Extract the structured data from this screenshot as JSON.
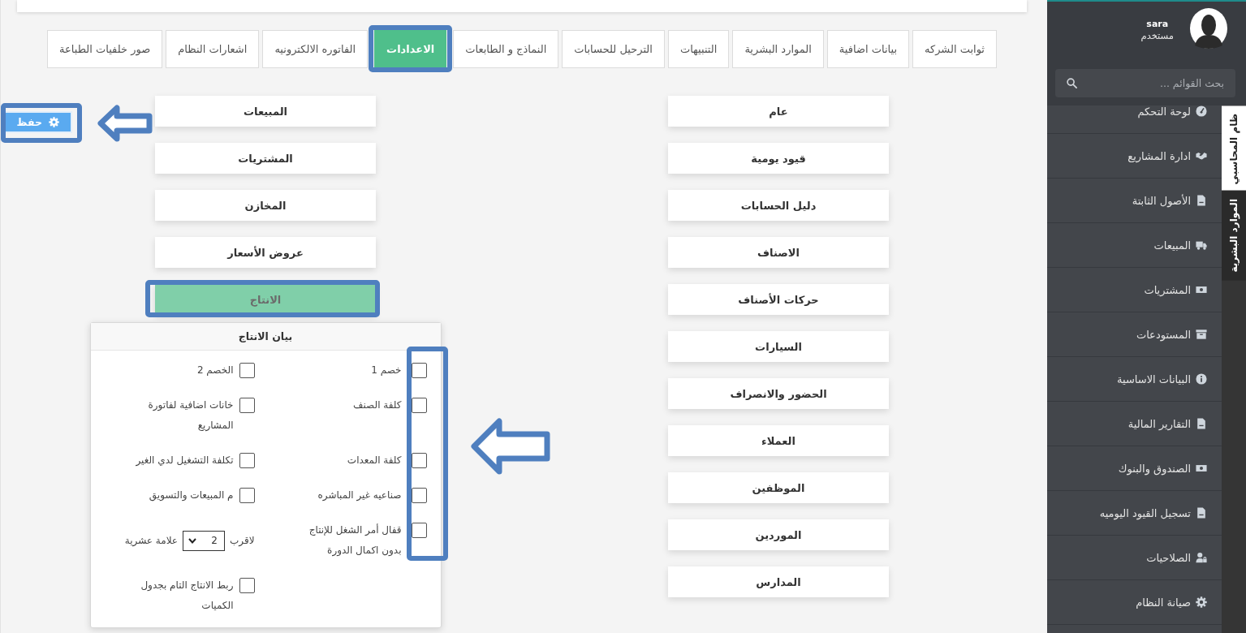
{
  "tabs": [
    {
      "label": "ثوابت الشركه",
      "selected": false,
      "annotated": false
    },
    {
      "label": "بيانات اضافية",
      "selected": false,
      "annotated": false
    },
    {
      "label": "الموارد البشرية",
      "selected": false,
      "annotated": false
    },
    {
      "label": "التنبيهات",
      "selected": false,
      "annotated": false
    },
    {
      "label": "الترحيل للحسابات",
      "selected": false,
      "annotated": false
    },
    {
      "label": "النماذج و الطابعات",
      "selected": false,
      "annotated": false
    },
    {
      "label": "الاعدادات",
      "selected": true,
      "annotated": true
    },
    {
      "label": "الفاتوره الالكترونيه",
      "selected": false,
      "annotated": false
    },
    {
      "label": "اشعارات النظام",
      "selected": false,
      "annotated": false
    },
    {
      "label": "صور خلفيات الطباعة",
      "selected": false,
      "annotated": false
    }
  ],
  "save_button": {
    "label": "حفظ",
    "annotated": true
  },
  "settings": {
    "right_column": [
      {
        "label": "عام",
        "selected": false,
        "annotated": false
      },
      {
        "label": "قيود يومية",
        "selected": false,
        "annotated": false
      },
      {
        "label": "دليل الحسابات",
        "selected": false,
        "annotated": false
      },
      {
        "label": "الاصناف",
        "selected": false,
        "annotated": false
      },
      {
        "label": "حركات الأصناف",
        "selected": false,
        "annotated": false
      },
      {
        "label": "السيارات",
        "selected": false,
        "annotated": false
      },
      {
        "label": "الحضور والانصراف",
        "selected": false,
        "annotated": false
      },
      {
        "label": "العملاء",
        "selected": false,
        "annotated": false
      },
      {
        "label": "الموظفين",
        "selected": false,
        "annotated": false
      },
      {
        "label": "الموردين",
        "selected": false,
        "annotated": false
      },
      {
        "label": "المدارس",
        "selected": false,
        "annotated": false
      }
    ],
    "left_column": [
      {
        "label": "المبيعات",
        "selected": false,
        "annotated": false
      },
      {
        "label": "المشتريات",
        "selected": false,
        "annotated": false
      },
      {
        "label": "المخازن",
        "selected": false,
        "annotated": false
      },
      {
        "label": "عروض الأسعار",
        "selected": false,
        "annotated": false
      },
      {
        "label": "الانتاج",
        "selected": true,
        "annotated": true
      }
    ]
  },
  "production_panel": {
    "title": "بيان الانتاج",
    "annotated": true,
    "right_items": [
      {
        "kind": "checkbox",
        "label": "خصم 1",
        "checked": false
      },
      {
        "kind": "checkbox",
        "label": "كلفة الصنف",
        "checked": false
      },
      {
        "kind": "checkbox",
        "label": "كلفة المعدات",
        "checked": false
      },
      {
        "kind": "checkbox",
        "label": "صناعيه غير المباشره",
        "checked": false
      },
      {
        "kind": "checkbox",
        "label": "قفال أمر الشغل للإنتاج بدون اكمال الدورة",
        "checked": false
      }
    ],
    "left_items": [
      {
        "kind": "checkbox",
        "label": "الخصم 2",
        "checked": false
      },
      {
        "kind": "checkbox",
        "label": "خانات اضافية لفاتورة المشاريع",
        "checked": false
      },
      {
        "kind": "checkbox",
        "label": "تكلفة التشغيل لدي الغير",
        "checked": false
      },
      {
        "kind": "checkbox",
        "label": "م المبيعات والتسويق",
        "checked": false
      },
      {
        "kind": "select",
        "label_before": "لاقرب",
        "value": "2",
        "label_after": "علامة عشرية"
      },
      {
        "kind": "checkbox",
        "label": "ربط الانتاج التام بجدول الكميات",
        "checked": false
      }
    ]
  },
  "sidebar": {
    "user": {
      "name": "sara",
      "role": "مستخدم"
    },
    "search": {
      "placeholder": "بحث القوائم ..."
    },
    "items": [
      {
        "label": "لوحة التحكم"
      },
      {
        "label": "ادارة المشاريع"
      },
      {
        "label": "الأصول الثابتة"
      },
      {
        "label": "المبيعات"
      },
      {
        "label": "المشتريات"
      },
      {
        "label": "المستودعات"
      },
      {
        "label": "البيانات الاساسية"
      },
      {
        "label": "التقارير المالية"
      },
      {
        "label": "الصندوق والبنوك"
      },
      {
        "label": "تسجيل القيود اليوميه"
      },
      {
        "label": "الصلاحيات"
      },
      {
        "label": "صيانة النظام"
      }
    ],
    "side_tabs": [
      {
        "label": "ظام المحاسبي",
        "selected": true
      },
      {
        "label": "الموارد البشرية",
        "selected": false
      }
    ]
  }
}
